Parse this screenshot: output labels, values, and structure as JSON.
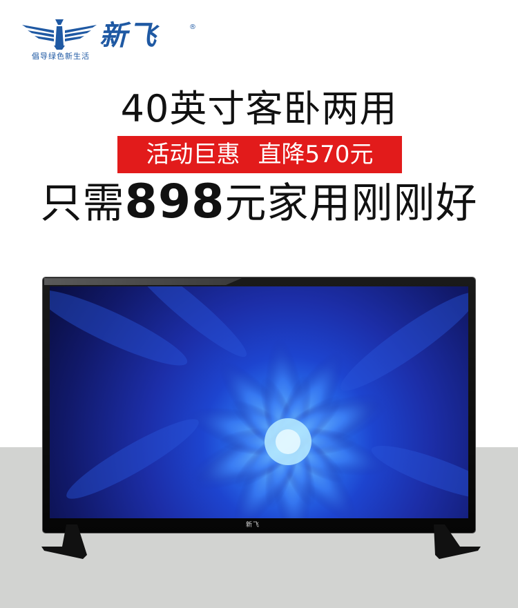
{
  "brand": {
    "name": "新飞",
    "registered_mark": "®",
    "slogan": "倡导绿色新生活",
    "logo_icon": "eagle-wings-icon",
    "color": "#1f59a3"
  },
  "headline": "40英寸客卧两用",
  "promo": {
    "part1": "活动巨惠",
    "part2": "直降570元",
    "background_color": "#e21b1b"
  },
  "price_line": {
    "prefix": "只需",
    "price": "898",
    "suffix": "元家用刚刚好"
  },
  "tv": {
    "bezel_logo": "新飞",
    "screen_image": "blue-flower-wallpaper"
  }
}
